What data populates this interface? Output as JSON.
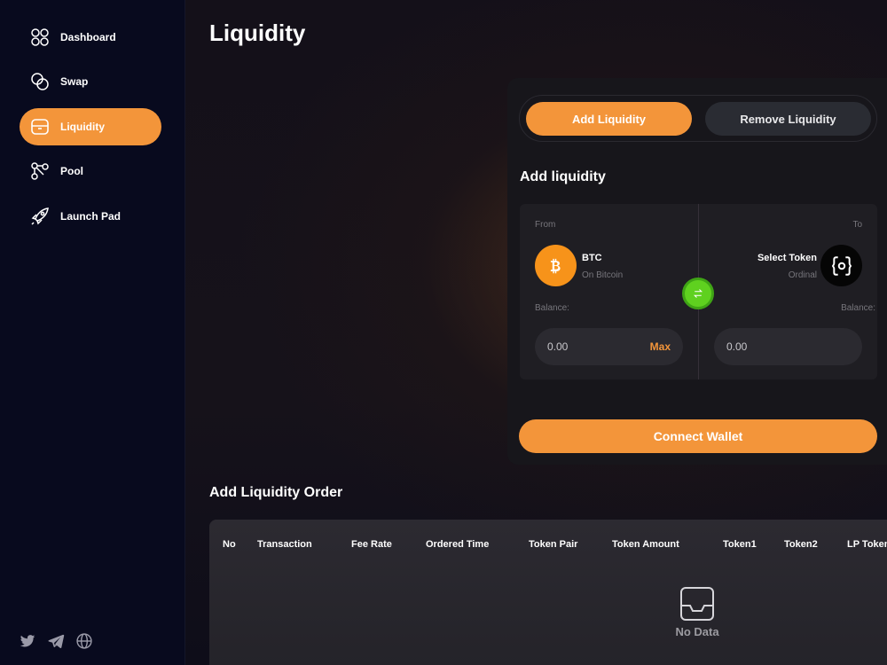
{
  "sidebar": {
    "items": [
      {
        "label": "Dashboard",
        "icon": "dashboard-icon",
        "active": false
      },
      {
        "label": "Swap",
        "icon": "swap-icon",
        "active": false
      },
      {
        "label": "Liquidity",
        "icon": "liquidity-icon",
        "active": true
      },
      {
        "label": "Pool",
        "icon": "pool-icon",
        "active": false
      },
      {
        "label": "Launch Pad",
        "icon": "rocket-icon",
        "active": false
      }
    ],
    "social": [
      "twitter-icon",
      "telegram-icon",
      "globe-icon"
    ]
  },
  "page": {
    "title": "Liquidity"
  },
  "card": {
    "tabs": {
      "add": "Add Liquidity",
      "remove": "Remove Liquidity"
    },
    "heading": "Add liquidity",
    "from": {
      "label": "From",
      "token": "BTC",
      "network": "On Bitcoin",
      "balance_label": "Balance:",
      "amount": "0.00",
      "max": "Max"
    },
    "to": {
      "label": "To",
      "token": "Select Token",
      "network": "Ordinal",
      "balance_label": "Balance:",
      "amount": "0.00"
    },
    "connect": "Connect Wallet"
  },
  "orders": {
    "title": "Add Liquidity Order",
    "columns": [
      "No",
      "Transaction",
      "Fee Rate",
      "Ordered Time",
      "Token Pair",
      "Token Amount",
      "Token1",
      "Token2",
      "LP Token"
    ],
    "empty": "No Data"
  },
  "colors": {
    "accent": "#f3953a",
    "toggle": "#5fd11f",
    "sidebar": "#080a1e"
  }
}
